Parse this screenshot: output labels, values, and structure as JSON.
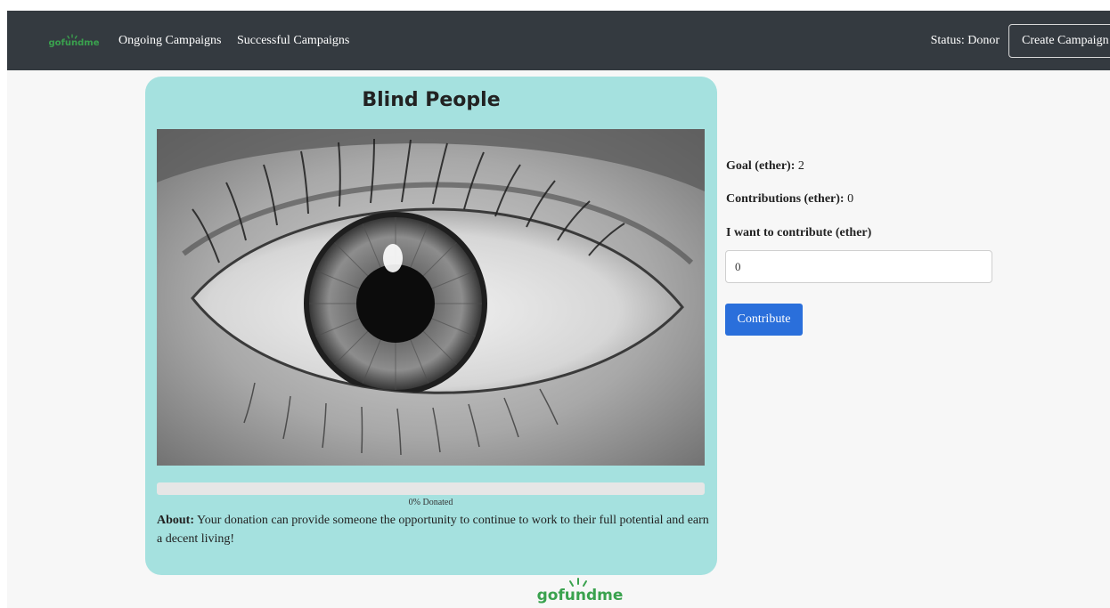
{
  "navbar": {
    "brand": "gofundme",
    "links": [
      "Ongoing Campaigns",
      "Successful Campaigns"
    ],
    "status": "Status: Donor",
    "create_label": "Create Campaign"
  },
  "campaign": {
    "title": "Blind People",
    "image_subject": "close-up black and white human eye",
    "progress_fraction": 0,
    "progress_label": "0% Donated",
    "about_label": "About:",
    "about_text": " Your donation can provide someone the opportunity to continue to work to their full potential and earn a decent living!"
  },
  "details": {
    "goal_label": "Goal (ether):",
    "goal_value": " 2",
    "contributions_label": "Contributions (ether):",
    "contributions_value": " 0",
    "contribute_label": "I want to contribute (ether)",
    "contribute_value": "0",
    "contribute_button": "Contribute"
  },
  "footer": {
    "brand": "gofundme"
  },
  "colors": {
    "navbar": "#343a40",
    "card": "#a5e1df",
    "brand": "#3aa24e",
    "button": "#2a6fdb",
    "background": "#f7f7f7"
  }
}
